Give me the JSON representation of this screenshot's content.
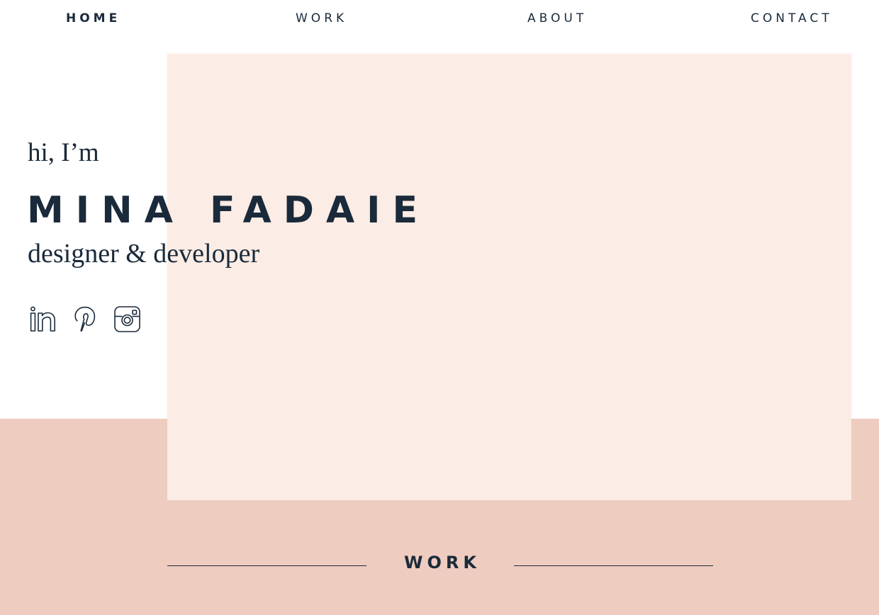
{
  "nav": {
    "home": "HOME",
    "work": "WORK",
    "about": "ABOUT",
    "contact": "CONTACT",
    "active": "HOME"
  },
  "hero": {
    "greeting": "hi, I’m",
    "name": "MINA FADAIE",
    "role": "designer & developer"
  },
  "social": {
    "icons": [
      "linkedin-icon",
      "pinterest-icon",
      "instagram-icon"
    ]
  },
  "work_section": {
    "heading": "WORK"
  },
  "colors": {
    "text": "#1a2a3a",
    "hero_panel": "#fbece5",
    "band": "#eeccbf",
    "background": "#ffffff"
  }
}
